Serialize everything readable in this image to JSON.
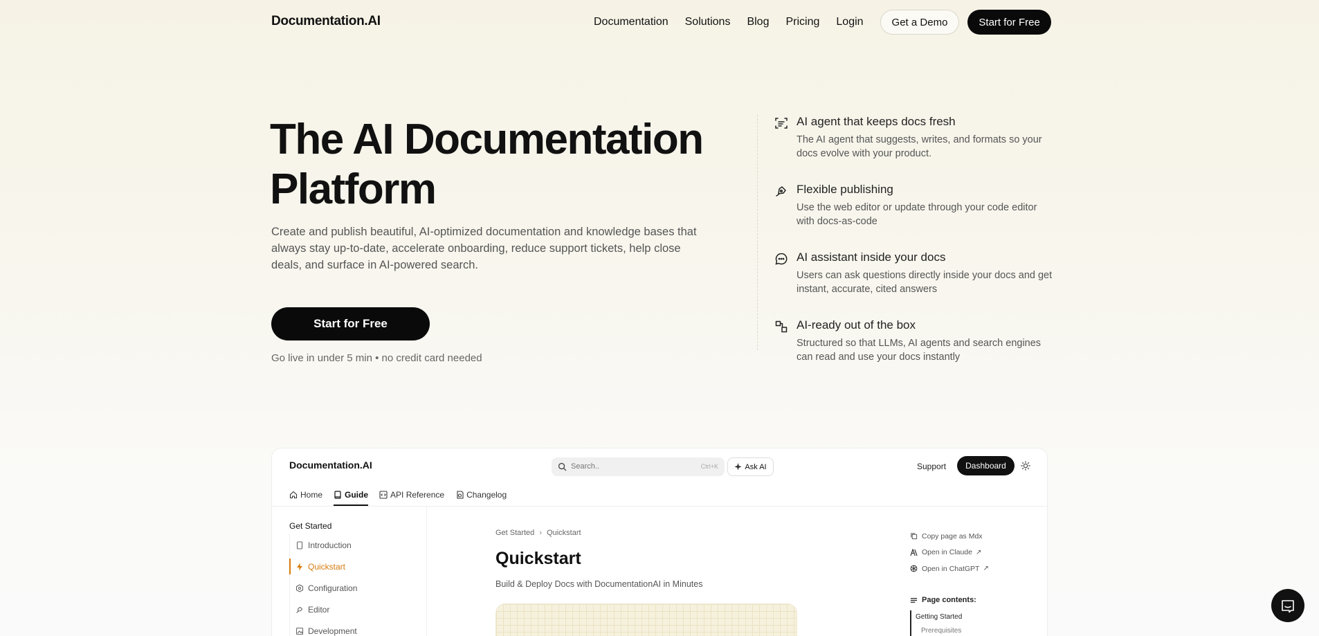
{
  "header": {
    "logo": "Documentation.AI",
    "links": [
      "Documentation",
      "Solutions",
      "Blog",
      "Pricing",
      "Login"
    ],
    "demo_label": "Get a Demo",
    "start_label": "Start for Free"
  },
  "hero": {
    "title_line1": "The AI Documentation",
    "title_line2": "Platform",
    "description": "Create and publish beautiful, AI-optimized documentation and knowledge bases that always stay up-to-date, accelerate onboarding, reduce support tickets, help close deals, and surface in AI-powered search.",
    "cta_label": "Start for Free",
    "note": "Go live in under 5 min • no credit card needed"
  },
  "features": [
    {
      "icon": "scan-text-icon",
      "title": "AI agent that keeps docs fresh",
      "desc": "The AI agent that suggests, writes, and formats so your docs evolve with your product."
    },
    {
      "icon": "pen-tool-icon",
      "title": "Flexible publishing",
      "desc": "Use the web editor or update through your code editor with docs-as-code"
    },
    {
      "icon": "chat-bubble-icon",
      "title": "AI assistant inside your docs",
      "desc": "Users can ask questions directly inside your docs and get instant, accurate, cited answers"
    },
    {
      "icon": "blocks-icon",
      "title": "AI-ready out of the box",
      "desc": "Structured so that LLMs, AI agents and search engines can read and use your docs instantly"
    }
  ],
  "preview": {
    "logo": "Documentation.AI",
    "search_placeholder": "Search..",
    "search_shortcut": "Ctrl+K",
    "ask_ai": "Ask AI",
    "support": "Support",
    "dashboard": "Dashboard",
    "tabs": [
      {
        "label": "Home",
        "icon": "home-icon"
      },
      {
        "label": "Guide",
        "icon": "book-icon"
      },
      {
        "label": "API Reference",
        "icon": "code-icon"
      },
      {
        "label": "Changelog",
        "icon": "history-icon"
      }
    ],
    "sidebar_heading": "Get Started",
    "sidebar_items": [
      {
        "label": "Introduction",
        "icon": "file-icon"
      },
      {
        "label": "Quickstart",
        "icon": "zap-icon"
      },
      {
        "label": "Configuration",
        "icon": "settings-icon"
      },
      {
        "label": "Editor",
        "icon": "pen-icon"
      },
      {
        "label": "Development",
        "icon": "image-icon"
      }
    ],
    "breadcrumb_1": "Get Started",
    "breadcrumb_2": "Quickstart",
    "page_title": "Quickstart",
    "page_subtitle": "Build & Deploy Docs with DocumentationAI in Minutes",
    "actions": [
      "Copy page as Mdx",
      "Open in Claude",
      "Open in ChatGPT"
    ],
    "contents_heading": "Page contents:",
    "contents": [
      "Getting Started",
      "Prerequisites"
    ]
  },
  "colors": {
    "accent": "#d67b0d",
    "primary": "#0a0a0a"
  }
}
